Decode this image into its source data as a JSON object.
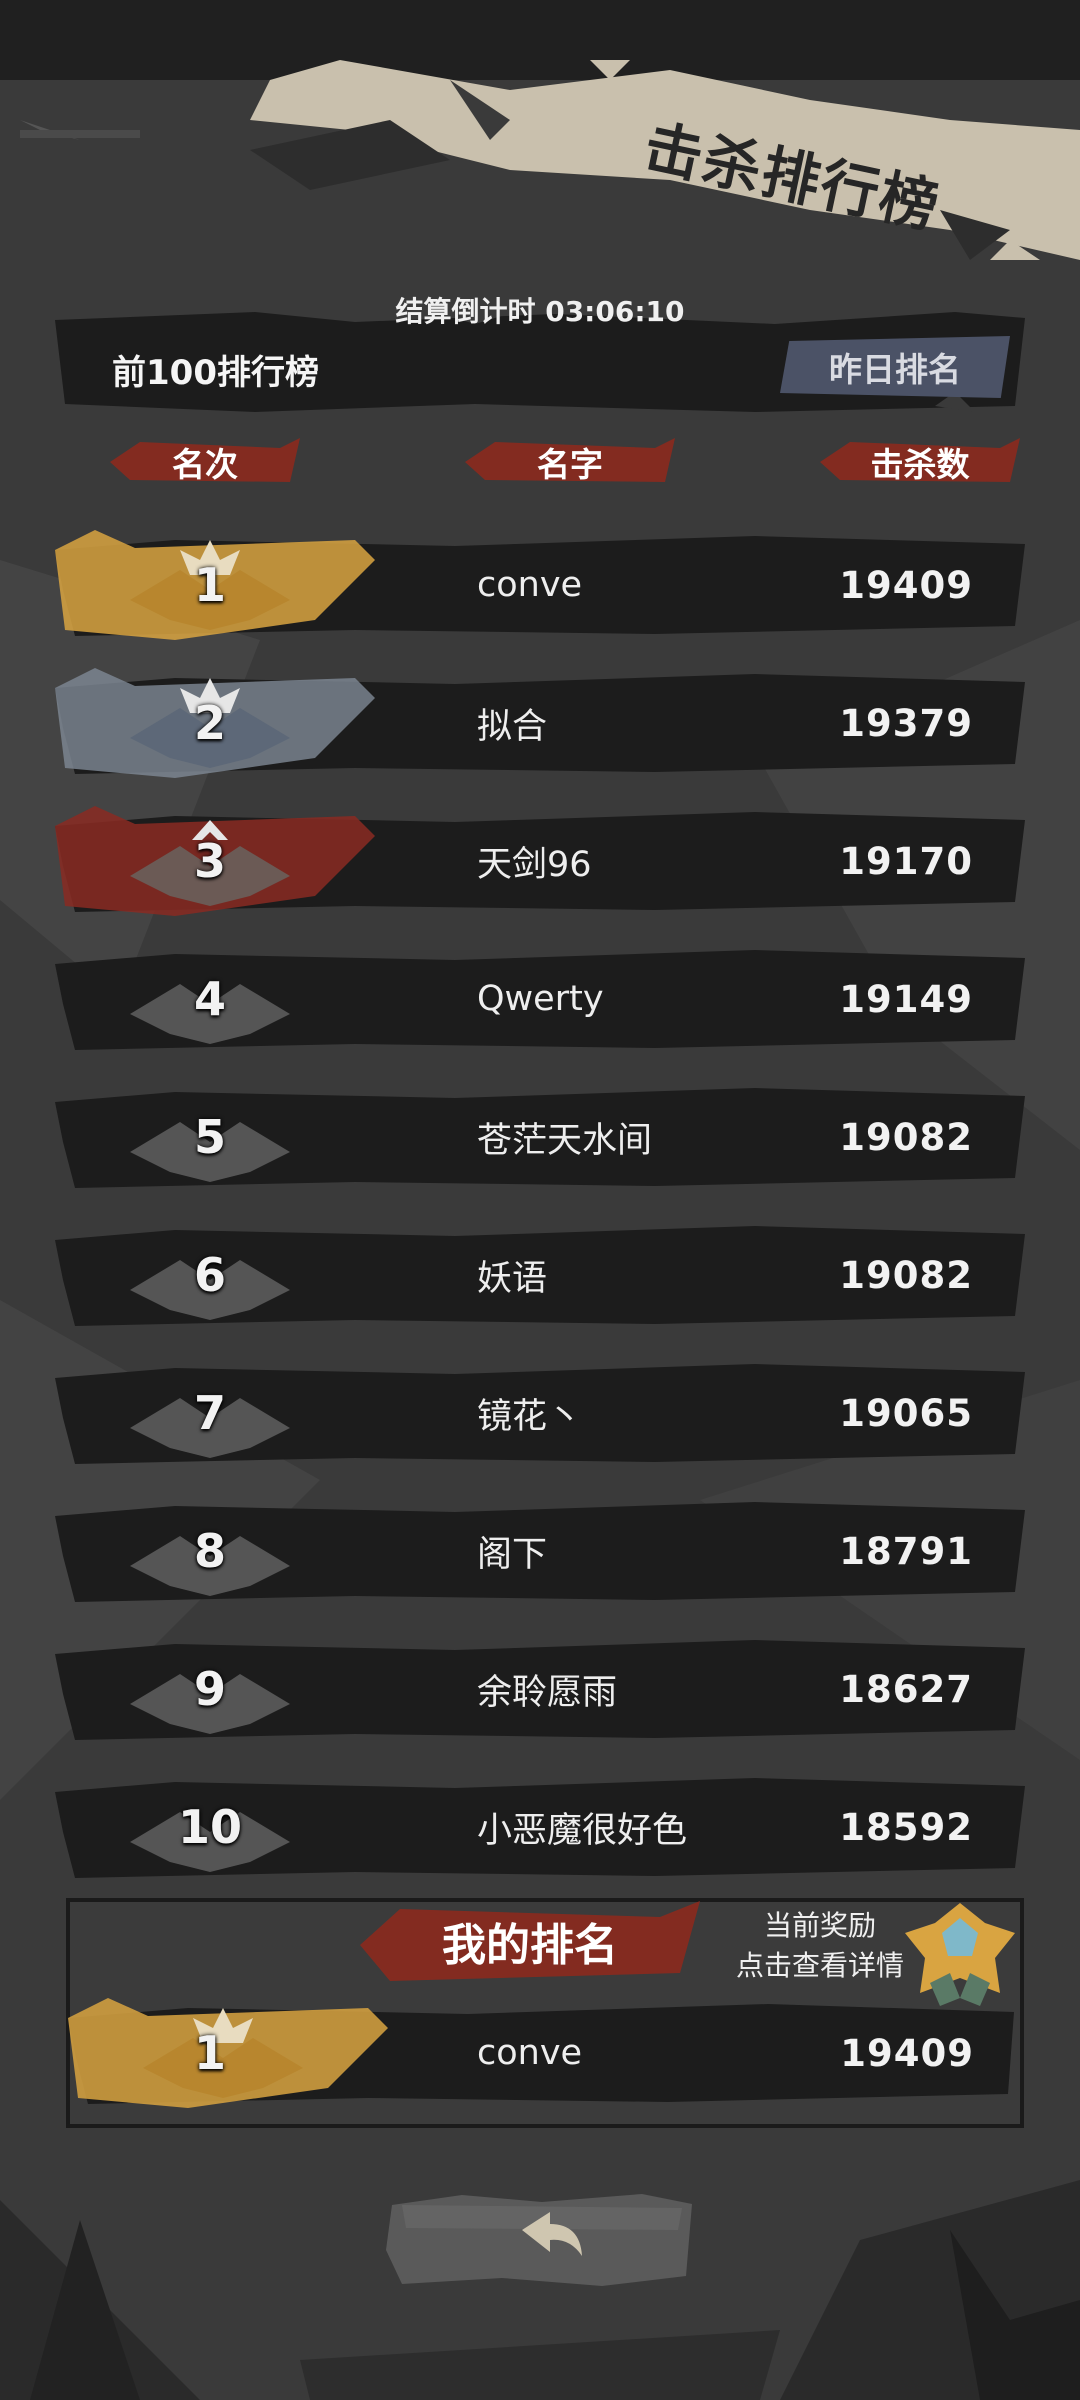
{
  "title": "击杀排行榜",
  "countdown": "结算倒计时 03:06:10",
  "top_label": "前100排行榜",
  "yesterday_button": "昨日排名",
  "columns": {
    "rank": "名次",
    "name": "名字",
    "kills": "击杀数"
  },
  "rows": [
    {
      "rank": "1",
      "name": "conve",
      "kills": "19409"
    },
    {
      "rank": "2",
      "name": "拟合",
      "kills": "19379"
    },
    {
      "rank": "3",
      "name": "天剑96",
      "kills": "19170"
    },
    {
      "rank": "4",
      "name": "Qwerty",
      "kills": "19149"
    },
    {
      "rank": "5",
      "name": "苍茫天水间",
      "kills": "19082"
    },
    {
      "rank": "6",
      "name": "妖语",
      "kills": "19082"
    },
    {
      "rank": "7",
      "name": "镜花丶",
      "kills": "19065"
    },
    {
      "rank": "8",
      "name": "阁下",
      "kills": "18791"
    },
    {
      "rank": "9",
      "name": "余聆愿雨",
      "kills": "18627"
    },
    {
      "rank": "10",
      "name": "小恶魔很好色",
      "kills": "18592"
    }
  ],
  "my_rank": {
    "title": "我的排名",
    "reward_line1": "当前奖励",
    "reward_line2": "点击查看详情",
    "rank": "1",
    "name": "conve",
    "kills": "19409"
  },
  "colors": {
    "gold": "#d9a441",
    "silver": "#7f8a96",
    "bronze": "#8a2a22",
    "accent_red": "#8c2a1e",
    "banner": "#c9c0ad"
  },
  "icons": {
    "back": "back-arrow-icon",
    "reward": "reward-medal-icon"
  }
}
